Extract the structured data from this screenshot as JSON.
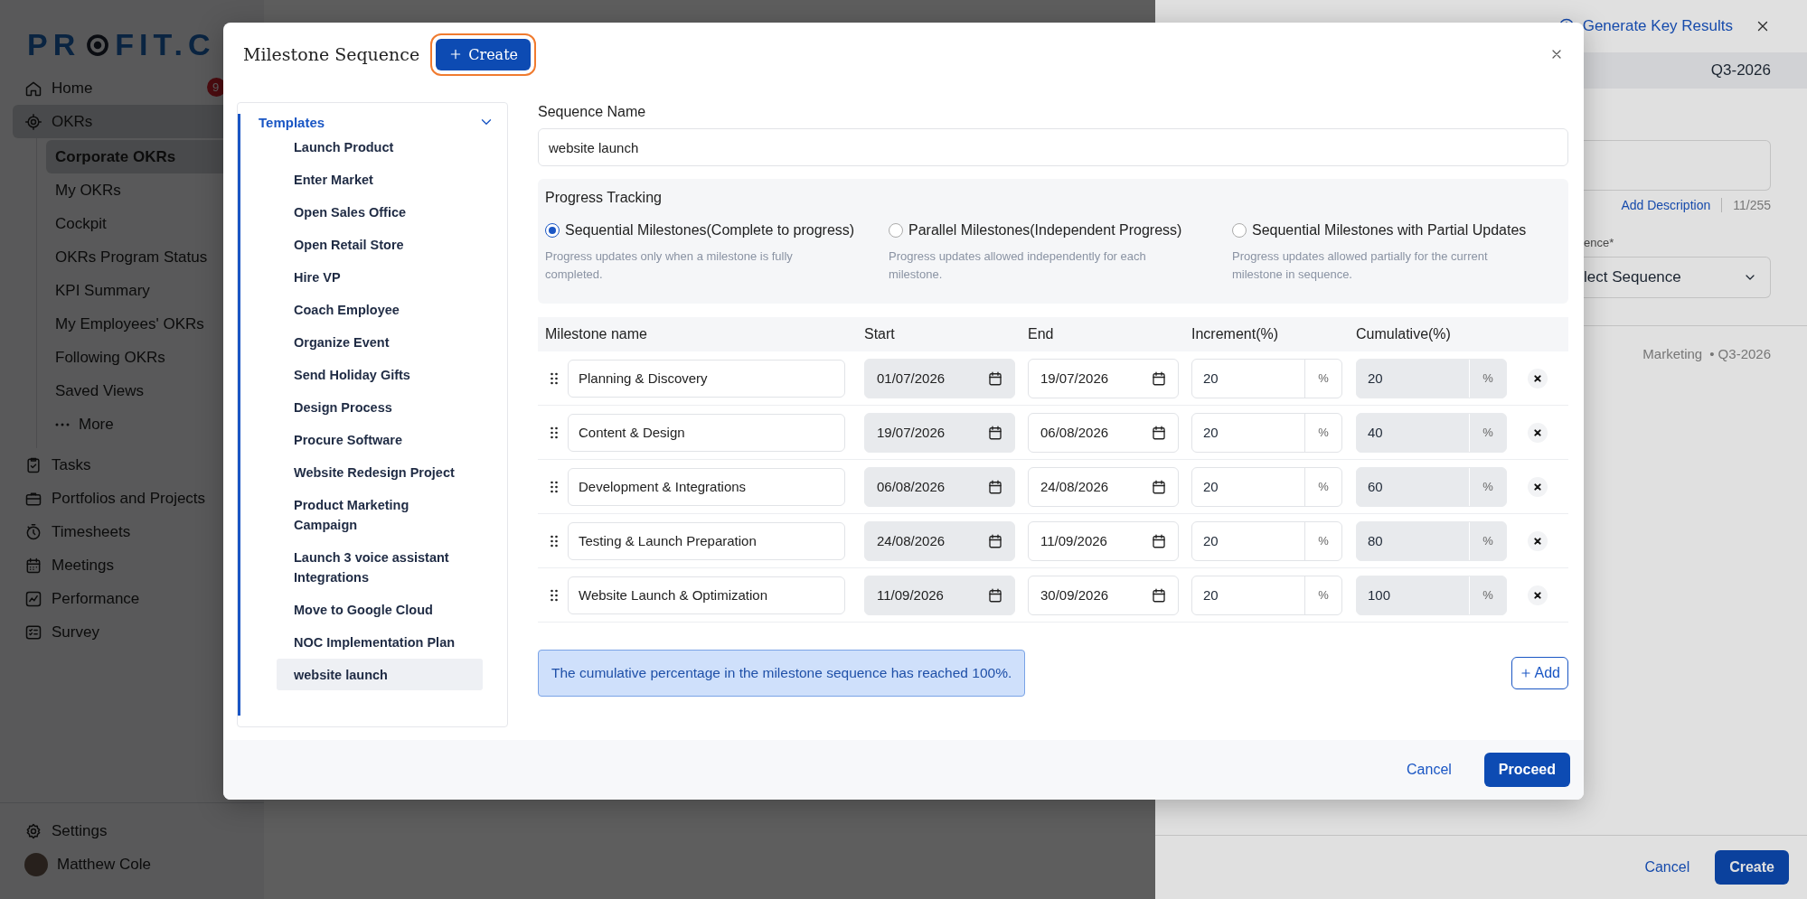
{
  "sidebar": {
    "logo": {
      "left": "PR",
      "right": "FIT.C"
    },
    "items": [
      {
        "label": "Home",
        "badge": "9",
        "selected": false
      },
      {
        "label": "OKRs",
        "selected": true,
        "expanded": true,
        "children": [
          {
            "label": "Corporate OKRs",
            "kind": "link",
            "selected": true
          },
          {
            "label": "My OKRs",
            "kind": "link",
            "selected": false
          },
          {
            "label": "Cockpit",
            "kind": "link",
            "selected": false
          },
          {
            "label": "OKRs Program Status",
            "kind": "link",
            "selected": false
          },
          {
            "label": "KPI Summary",
            "kind": "link",
            "selected": false
          },
          {
            "label": "My Employees' OKRs",
            "kind": "link",
            "selected": false
          },
          {
            "label": "Following OKRs",
            "kind": "link",
            "selected": false
          },
          {
            "label": "Saved Views",
            "kind": "link",
            "selected": false
          },
          {
            "label": "More",
            "kind": "more",
            "selected": false
          }
        ]
      },
      {
        "label": "Tasks",
        "selected": false
      },
      {
        "label": "Portfolios and Projects",
        "selected": false
      },
      {
        "label": "Timesheets",
        "selected": false
      },
      {
        "label": "Meetings",
        "selected": false
      },
      {
        "label": "Performance",
        "selected": false
      },
      {
        "label": "Survey",
        "selected": false
      }
    ],
    "settings": "Settings",
    "user": "Matthew Cole"
  },
  "right_panel": {
    "generate": "Generate Key Results",
    "period": "Q3-2026",
    "description_link": "Add Description",
    "counter": "11/255",
    "sequence_label": "ence*",
    "sequence_value": "lect Sequence",
    "meta_team": "Marketing",
    "meta_period": "• Q3-2026",
    "cancel": "Cancel",
    "create": "Create"
  },
  "modal": {
    "title": "Milestone Sequence",
    "create_button": "Create",
    "templates": {
      "heading": "Templates",
      "expanded": true,
      "items": [
        {
          "label": "Launch Product",
          "selected": false
        },
        {
          "label": "Enter Market",
          "selected": false
        },
        {
          "label": "Open Sales Office",
          "selected": false
        },
        {
          "label": "Open Retail Store",
          "selected": false
        },
        {
          "label": "Hire VP",
          "selected": false
        },
        {
          "label": "Coach Employee",
          "selected": false
        },
        {
          "label": "Organize Event",
          "selected": false
        },
        {
          "label": "Send Holiday Gifts",
          "selected": false
        },
        {
          "label": "Design Process",
          "selected": false
        },
        {
          "label": "Procure Software",
          "selected": false
        },
        {
          "label": "Website Redesign Project",
          "selected": false
        },
        {
          "label": "Product Marketing Campaign",
          "selected": false
        },
        {
          "label": "Launch 3 voice assistant Integrations",
          "selected": false
        },
        {
          "label": "Move to Google Cloud",
          "selected": false
        },
        {
          "label": "NOC Implementation Plan",
          "selected": false
        },
        {
          "label": "website launch",
          "selected": true
        }
      ]
    },
    "sequence_name": {
      "label": "Sequence Name",
      "value": "website launch"
    },
    "progress_tracking": {
      "title": "Progress Tracking",
      "options": [
        {
          "label": "Sequential Milestones(Complete to progress)",
          "description": "Progress updates only when a milestone is fully completed.",
          "selected": true
        },
        {
          "label": "Parallel Milestones(Independent Progress)",
          "description": "Progress updates allowed independently for each milestone.",
          "selected": false
        },
        {
          "label": "Sequential Milestones with Partial Updates",
          "description": "Progress updates allowed partially for the current milestone in sequence.",
          "selected": false
        }
      ]
    },
    "table": {
      "columns": [
        "Milestone name",
        "Start",
        "End",
        "Increment(%)",
        "Cumulative(%)"
      ],
      "rows": [
        {
          "name": "Planning & Discovery",
          "start": {
            "value": "01/07/2026",
            "disabled": true
          },
          "end": {
            "value": "19/07/2026",
            "disabled": false
          },
          "increment": {
            "value": "20",
            "unit": "%",
            "disabled": false
          },
          "cumulative": {
            "value": "20",
            "unit": "%",
            "disabled": true
          }
        },
        {
          "name": "Content & Design",
          "start": {
            "value": "19/07/2026",
            "disabled": true
          },
          "end": {
            "value": "06/08/2026",
            "disabled": false
          },
          "increment": {
            "value": "20",
            "unit": "%",
            "disabled": false
          },
          "cumulative": {
            "value": "40",
            "unit": "%",
            "disabled": true
          }
        },
        {
          "name": "Development & Integrations",
          "start": {
            "value": "06/08/2026",
            "disabled": true
          },
          "end": {
            "value": "24/08/2026",
            "disabled": false
          },
          "increment": {
            "value": "20",
            "unit": "%",
            "disabled": false
          },
          "cumulative": {
            "value": "60",
            "unit": "%",
            "disabled": true
          }
        },
        {
          "name": "Testing & Launch Preparation",
          "start": {
            "value": "24/08/2026",
            "disabled": true
          },
          "end": {
            "value": "11/09/2026",
            "disabled": false
          },
          "increment": {
            "value": "20",
            "unit": "%",
            "disabled": false
          },
          "cumulative": {
            "value": "80",
            "unit": "%",
            "disabled": true
          }
        },
        {
          "name": "Website Launch & Optimization",
          "start": {
            "value": "11/09/2026",
            "disabled": true
          },
          "end": {
            "value": "30/09/2026",
            "disabled": false
          },
          "increment": {
            "value": "20",
            "unit": "%",
            "disabled": false
          },
          "cumulative": {
            "value": "100",
            "unit": "%",
            "disabled": true
          }
        }
      ]
    },
    "alert": "The cumulative percentage in the milestone sequence has reached 100%.",
    "add_button": "Add",
    "cancel": "Cancel",
    "proceed": "Proceed"
  }
}
